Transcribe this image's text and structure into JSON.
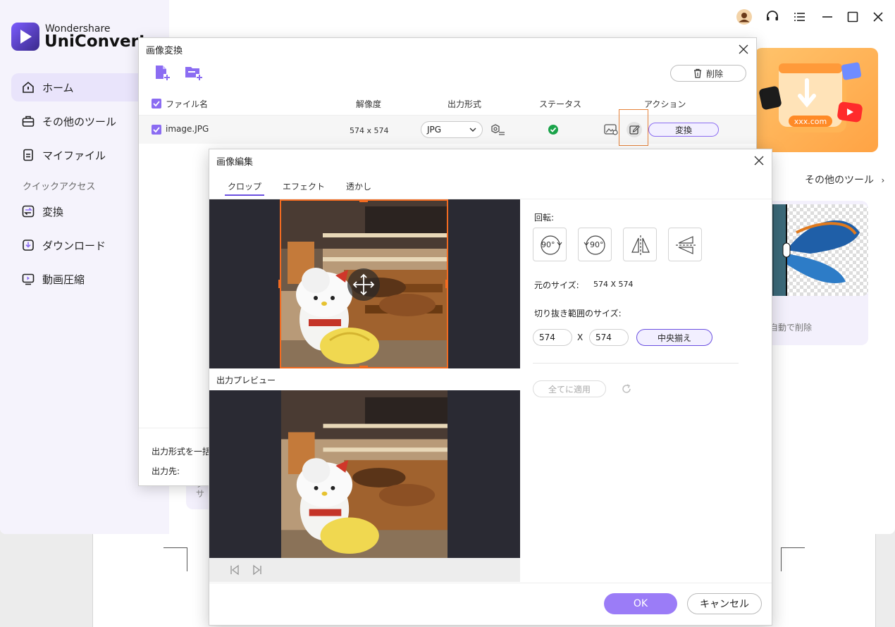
{
  "app": {
    "brand_small": "Wondershare",
    "brand_big": "UniConverter",
    "nav": [
      {
        "label": "ホーム",
        "icon": "home-icon"
      },
      {
        "label": "その他のツール",
        "icon": "toolbox-icon"
      },
      {
        "label": "マイファイル",
        "icon": "file-icon"
      }
    ],
    "quick_access_title": "クイックアクセス",
    "quick": [
      {
        "label": "変換",
        "icon": "convert-icon"
      },
      {
        "label": "ダウンロード",
        "icon": "download-icon"
      },
      {
        "label": "動画圧縮",
        "icon": "compress-icon"
      }
    ],
    "other_tools_link": "その他のツール",
    "auto_delete_text": "自動で削除",
    "promo_badge": "xxx.com",
    "hint_lines": [
      "ク",
      "サ"
    ],
    "accent_color": "#8b6cf2"
  },
  "convert_dialog": {
    "title": "画像変換",
    "delete_label": "削除",
    "headers": {
      "filename": "ファイル名",
      "resolution": "解像度",
      "output_format": "出力形式",
      "status": "ステータス",
      "action": "アクション"
    },
    "file": {
      "name": "image.JPG",
      "resolution": "574 x 574",
      "format": "JPG",
      "convert_label": "変換"
    },
    "footer": {
      "batch_format_label": "出力形式を一括",
      "output_dest_label": "出力先:"
    }
  },
  "edit_dialog": {
    "title": "画像編集",
    "tabs": [
      "クロップ",
      "エフェクト",
      "透かし"
    ],
    "active_tab": "クロップ",
    "preview_label": "出力プレビュー",
    "rotation_label": "回転:",
    "rotate_buttons": {
      "cw_label": "90°",
      "ccw_label": "90°"
    },
    "original_size_label": "元のサイズ:",
    "original_size_value": "574 X 574",
    "crop_size_label": "切り抜き範囲のサイズ:",
    "crop_width": "574",
    "crop_x": "X",
    "crop_height": "574",
    "center_label": "中央揃え",
    "apply_all_label": "全てに適用",
    "ok_label": "OK",
    "cancel_label": "キャンセル",
    "crop_color": "#f26b21"
  }
}
